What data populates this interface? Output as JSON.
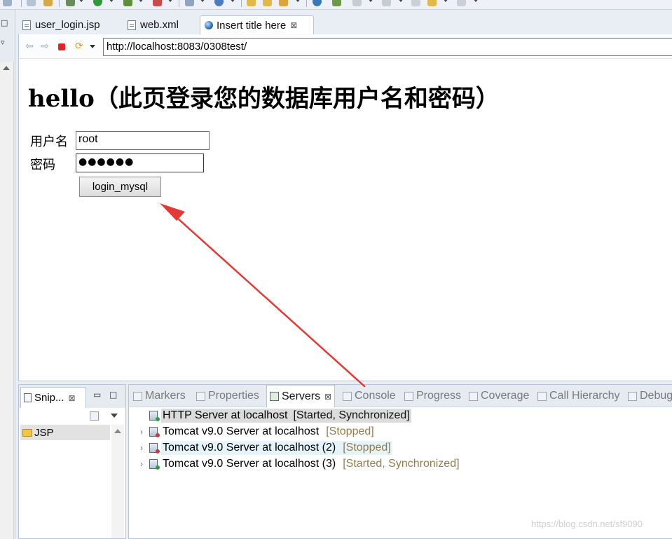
{
  "editor_tabs": [
    {
      "label": "user_login.jsp",
      "active": false
    },
    {
      "label": "web.xml",
      "active": false
    },
    {
      "label": "Insert title here",
      "active": true,
      "close": "⊠"
    }
  ],
  "browser": {
    "url": "http://localhost:8083/0308test/"
  },
  "page": {
    "heading": "hello（此页登录您的数据库用户名和密码）",
    "username_label": "用户名",
    "username_value": "root",
    "password_label": "密码",
    "password_mask": "●●●●●●",
    "submit_label": "login_mysql"
  },
  "snippets": {
    "tab_label": "Snip...",
    "close": "⊠",
    "item": "JSP",
    "minimize": "▭",
    "maximize": "□"
  },
  "panel_tabs": {
    "markers": "Markers",
    "properties": "Properties",
    "servers": "Servers",
    "console": "Console",
    "progress": "Progress",
    "coverage": "Coverage",
    "call_hierarchy": "Call Hierarchy",
    "debug": "Debug",
    "close": "⊠"
  },
  "servers": [
    {
      "name": "HTTP Server at localhost",
      "state": "[Started, Synchronized]",
      "status_color": "#2e9e3a"
    },
    {
      "name": "Tomcat v9.0 Server at localhost",
      "state": "[Stopped]",
      "status_color": "#c23a3a"
    },
    {
      "name": "Tomcat v9.0 Server at localhost (2)",
      "state": "[Stopped]",
      "status_color": "#c23a3a"
    },
    {
      "name": "Tomcat v9.0 Server at localhost (3)",
      "state": "[Started, Synchronized]",
      "status_color": "#2e9e3a"
    }
  ],
  "watermark": "https://blog.csdn.net/sf9090",
  "colors": {
    "annotation_arrow": "#e53935"
  }
}
